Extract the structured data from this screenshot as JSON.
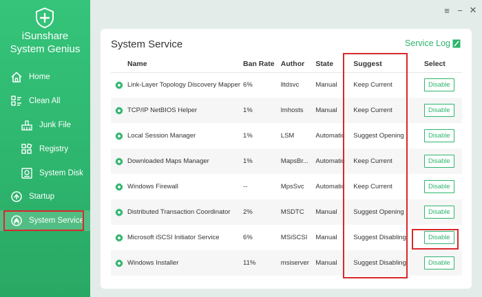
{
  "app": {
    "brand_line1": "iSunshare",
    "brand_line2": "System Genius",
    "accent_color": "#2db46d",
    "highlight_color": "#d9262a"
  },
  "sidebar": {
    "items": [
      {
        "label": "Home",
        "icon": "home-icon"
      },
      {
        "label": "Clean All",
        "icon": "clean-all-icon"
      },
      {
        "label": "Junk File",
        "icon": "junk-file-icon"
      },
      {
        "label": "Registry",
        "icon": "registry-icon"
      },
      {
        "label": "System Disk",
        "icon": "system-disk-icon"
      },
      {
        "label": "Startup",
        "icon": "startup-icon"
      },
      {
        "label": "System Service",
        "icon": "system-service-icon",
        "active": true
      }
    ]
  },
  "window_controls": {
    "menu": "≡",
    "minimize": "−",
    "close": "✕"
  },
  "main": {
    "title": "System Service",
    "service_log": "Service Log",
    "table": {
      "headers": {
        "name": "Name",
        "ban_rate": "Ban Rate",
        "author": "Author",
        "state": "State",
        "suggest": "Suggest",
        "select": "Select"
      },
      "rows": [
        {
          "name": "Link-Layer Topology Discovery Mapper",
          "ban_rate": "6%",
          "author": "lltdsvc",
          "state": "Manual",
          "suggest": "Keep Current",
          "action": "Disable"
        },
        {
          "name": "TCP/IP NetBIOS Helper",
          "ban_rate": "1%",
          "author": "lmhosts",
          "state": "Manual",
          "suggest": "Keep Current",
          "action": "Disable"
        },
        {
          "name": "Local Session Manager",
          "ban_rate": "1%",
          "author": "LSM",
          "state": "Automatic",
          "suggest": "Suggest Opening",
          "action": "Disable"
        },
        {
          "name": "Downloaded Maps Manager",
          "ban_rate": "1%",
          "author": "MapsBr...",
          "state": "Automatic",
          "suggest": "Keep Current",
          "action": "Disable"
        },
        {
          "name": "Windows Firewall",
          "ban_rate": "--",
          "author": "MpsSvc",
          "state": "Automatic",
          "suggest": "Keep Current",
          "action": "Disable"
        },
        {
          "name": "Distributed Transaction Coordinator",
          "ban_rate": "2%",
          "author": "MSDTC",
          "state": "Manual",
          "suggest": "Suggest Opening",
          "action": "Disable"
        },
        {
          "name": "Microsoft iSCSI Initiator Service",
          "ban_rate": "6%",
          "author": "MSiSCSI",
          "state": "Manual",
          "suggest": "Suggest Disabling",
          "action": "Disable"
        },
        {
          "name": "Windows Installer",
          "ban_rate": "11%",
          "author": "msiserver",
          "state": "Manual",
          "suggest": "Suggest Disabling",
          "action": "Disable"
        }
      ]
    }
  }
}
